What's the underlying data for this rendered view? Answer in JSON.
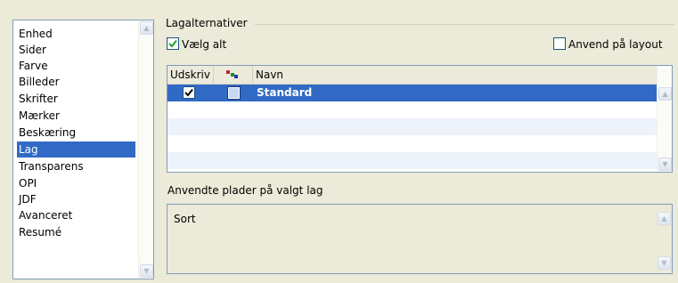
{
  "categories": [
    {
      "label": "Enhed"
    },
    {
      "label": "Sider"
    },
    {
      "label": "Farve"
    },
    {
      "label": "Billeder"
    },
    {
      "label": "Skrifter"
    },
    {
      "label": "Mærker"
    },
    {
      "label": "Beskæring"
    },
    {
      "label": "Lag",
      "selected": true
    },
    {
      "label": "Transparens"
    },
    {
      "label": "OPI"
    },
    {
      "label": "JDF"
    },
    {
      "label": "Avanceret"
    },
    {
      "label": "Resumé"
    }
  ],
  "layers_group": {
    "title": "Lagalternativer",
    "select_all_label": "Vælg alt",
    "select_all_checked": true,
    "apply_layout_label": "Anvend på layout",
    "apply_layout_checked": false
  },
  "layer_table": {
    "columns": [
      "Udskriv",
      "",
      "Navn"
    ],
    "rows": [
      {
        "print": true,
        "name": "Standard",
        "selected": true
      }
    ]
  },
  "plates": {
    "label": "Anvendte plader på valgt lag",
    "items": [
      "Sort"
    ]
  },
  "colors": {
    "selection": "#316ac5",
    "panel_bg": "#ecead8",
    "check_green": "#21a121",
    "border": "#7f9db9"
  },
  "icons": {
    "column_icon": "layer-color-icon",
    "scroll_up": "scroll-up-icon",
    "scroll_down": "scroll-down-icon"
  }
}
